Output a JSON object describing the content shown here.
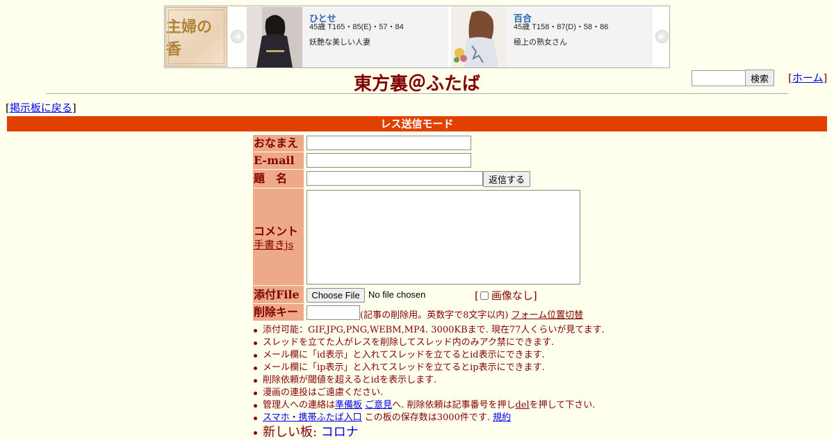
{
  "banner": {
    "logo_text": "主婦の香",
    "cards": [
      {
        "name": "ひとせ",
        "spec": "45歳 T165・85(E)・57・84",
        "desc": "妖艶な美しい人妻"
      },
      {
        "name": "百合",
        "spec": "45歳 T158・87(D)・58・86",
        "desc": "極上の熟女さん"
      }
    ]
  },
  "header": {
    "title": "東方裏＠ふたば",
    "search_button": "検索",
    "home_link": "ホーム",
    "back_link": "掲示板に戻る"
  },
  "mode_bar": "レス送信モード",
  "form": {
    "name_label": "おなまえ",
    "email_label": "E-mail",
    "subject_label": "題　名",
    "submit_button": "返信する",
    "comment_label": "コメント",
    "handwriting_link": "手書きjs",
    "file_label": "添付File",
    "choose_file_button": "Choose File",
    "no_file_text": "No file chosen",
    "no_image_label": "画像なし",
    "delete_key_label": "削除キー",
    "delete_key_note": "(記事の削除用。英数字で8文字以内)",
    "form_toggle_link": "フォーム位置切替"
  },
  "rules": {
    "r1": "添付可能：GIF,JPG,PNG,WEBM,MP4. 3000KBまで. 現在77人くらいが見てます.",
    "r2": "スレッドを立てた人がレスを削除してスレッド内のみアク禁にできます.",
    "r3": "メール欄に「id表示」と入れてスレッドを立てるとid表示にできます.",
    "r4": "メール欄に「ip表示」と入れてスレッドを立てるとip表示にできます.",
    "r5": "削除依頼が閾値を超えるとidを表示します.",
    "r6": "漫画の連投はご遠慮ください.",
    "r7_a": "管理人への連絡は",
    "r7_link1": "準備板",
    "r7_link2": "ご意見",
    "r7_b": "へ. 削除依頼は記事番号を押し",
    "r7_del": "del",
    "r7_c": "を押して下さい.",
    "r8_link": "スマホ・携帯ふたば入口",
    "r8_a": "この板の保存数は3000件です.",
    "r8_rules_link": "規約",
    "r9_a": "新しい板: ",
    "r9_link": "コロナ"
  }
}
